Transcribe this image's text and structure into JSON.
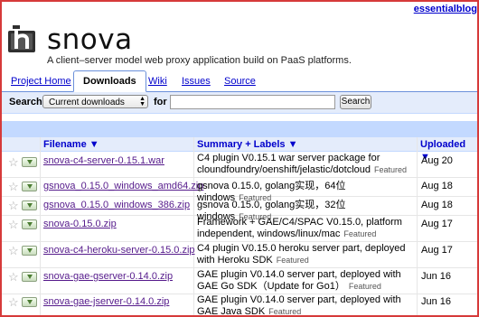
{
  "header": {
    "top_link": "essentialblog",
    "project_name": "snova",
    "summary": "A client–server model web proxy application build on PaaS platforms."
  },
  "tabs": [
    {
      "label": "Project Home",
      "active": false
    },
    {
      "label": "Downloads",
      "active": true
    },
    {
      "label": "Wiki",
      "active": false
    },
    {
      "label": "Issues",
      "active": false
    },
    {
      "label": "Source",
      "active": false
    }
  ],
  "search": {
    "label": "Search",
    "scope_selected": "Current downloads",
    "for_label": "for",
    "query_value": "",
    "button_label": "Search"
  },
  "table": {
    "columns": [
      "Filename ▼",
      "Summary + Labels ▼",
      "Uploaded ▼"
    ],
    "rows": [
      {
        "filename": "snova-c4-server-0.15.1.war",
        "summary": "C4 plugin V0.15.1 war server package for cloundfoundry/oenshift/jelastic/dotcloud",
        "label": "Featured",
        "uploaded": "Aug 20"
      },
      {
        "filename": "gsnova_0.15.0_windows_amd64.zip",
        "summary": "gsnova 0.15.0, golang实现，64位windows",
        "label": "Featured",
        "uploaded": "Aug 18"
      },
      {
        "filename": "gsnova_0.15.0_windows_386.zip",
        "summary": "gsnova 0.15.0, golang实现，32位windows",
        "label": "Featured",
        "uploaded": "Aug 18"
      },
      {
        "filename": "snova-0.15.0.zip",
        "summary": "Framework + GAE/C4/SPAC V0.15.0, platform independent, windows/linux/mac",
        "label": "Featured",
        "uploaded": "Aug 17"
      },
      {
        "filename": "snova-c4-heroku-server-0.15.0.zip",
        "summary": "C4 plugin V0.15.0 heroku server part, deployed with Heroku SDK",
        "label": "Featured",
        "uploaded": "Aug 17"
      },
      {
        "filename": "snova-gae-gserver-0.14.0.zip",
        "summary": "GAE plugin V0.14.0 server part, deployed with GAE Go SDK（Update for Go1）",
        "label": "Featured",
        "uploaded": "Jun 16"
      },
      {
        "filename": "snova-gae-jserver-0.14.0.zip",
        "summary": "GAE plugin V0.14.0 server part, deployed with GAE Java SDK",
        "label": "Featured",
        "uploaded": "Jun 16"
      }
    ]
  },
  "icons": {
    "logo": "snova-logo-icon",
    "star": "star-icon",
    "download": "download-icon",
    "select_arrows": "select-arrows-icon"
  },
  "colors": {
    "frame_border": "#d63a3a",
    "link": "#0000cc",
    "visited_link": "#551a8b",
    "header_bg": "#e4ecfb",
    "accent_bar": "#c3d9ff"
  }
}
